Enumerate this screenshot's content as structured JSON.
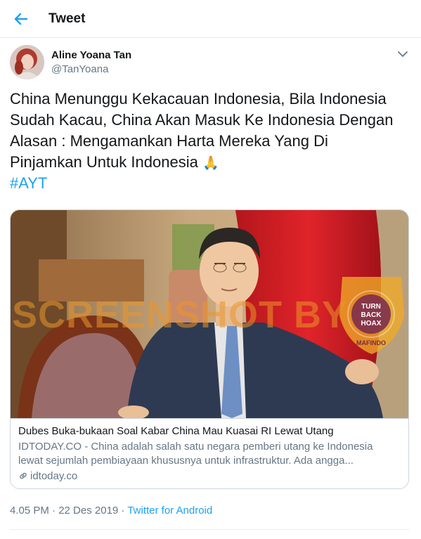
{
  "header": {
    "title": "Tweet",
    "back_icon": "arrow-left-icon",
    "accent": "#1da1f2"
  },
  "author": {
    "name": "Aline Yoana Tan",
    "handle": "@TanYoana",
    "avatar_icon": "user-avatar"
  },
  "tweet": {
    "text": "China Menunggu Kekacauan Indonesia, Bila Indonesia\nSudah Kacau, China Akan Masuk Ke Indonesia Dengan\nAlasan : Mengamankan Harta Mereka Yang Di\nPinjamkan Untuk Indonesia ",
    "emoji": "🙏",
    "hashtag": "#AYT"
  },
  "card": {
    "watermark": "SCREENSHOT BY",
    "badge_text": "MASYARAKAT ANTI FITNAH INDONESIA · TURN BACK HOAX · MAFINDO",
    "title": "Dubes Buka-bukaan Soal Kabar China Mau Kuasai RI Lewat Utang",
    "description": "IDTODAY.CO - China adalah salah satu negara pemberi utang ke Indonesia lewat sejumlah pembiayaan khususnya untuk infrastruktur. Ada angga...",
    "domain": "idtoday.co"
  },
  "meta": {
    "timestamp": "4.05 PM · 22 Des 2019 · ",
    "source": "Twitter for Android"
  }
}
